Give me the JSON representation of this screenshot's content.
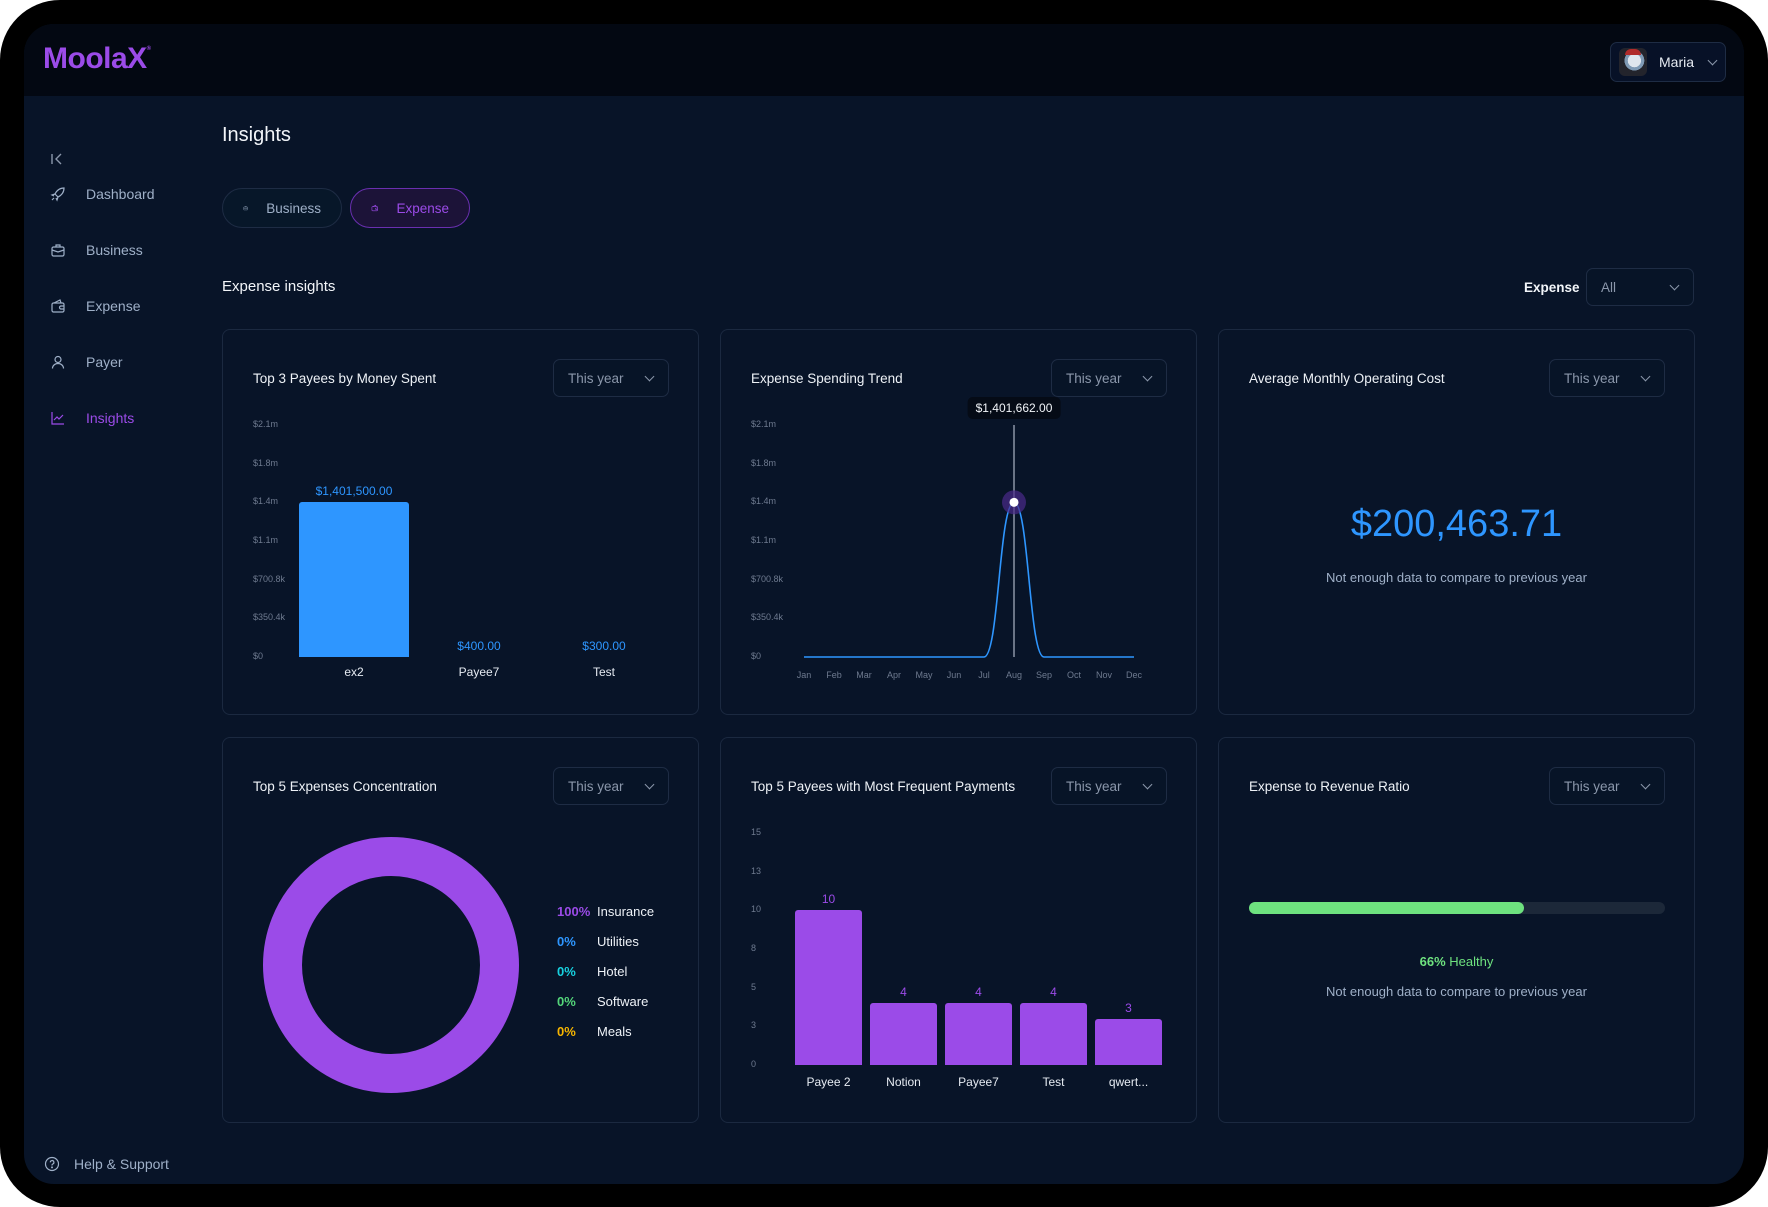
{
  "app": {
    "logo": "MoolaX",
    "logo_mark": "®"
  },
  "user": {
    "name": "Maria"
  },
  "sidebar": {
    "items": [
      {
        "label": "Dashboard",
        "icon": "rocket-icon",
        "active": false
      },
      {
        "label": "Business",
        "icon": "briefcase-icon",
        "active": false
      },
      {
        "label": "Expense",
        "icon": "wallet-icon",
        "active": false
      },
      {
        "label": "Payer",
        "icon": "user-icon",
        "active": false
      },
      {
        "label": "Insights",
        "icon": "chart-line-icon",
        "active": true
      }
    ],
    "help": "Help & Support"
  },
  "page": {
    "title": "Insights",
    "tabs": [
      {
        "label": "Business",
        "active": false
      },
      {
        "label": "Expense",
        "active": true
      }
    ],
    "section_title": "Expense insights",
    "filter": {
      "label": "Expense",
      "value": "All"
    }
  },
  "colors": {
    "accent_purple": "#9b4be8",
    "accent_blue": "#2e96ff",
    "healthy_green": "#6ee27f",
    "legend": [
      "#9b4be8",
      "#2e96ff",
      "#17d1e0",
      "#54d67a",
      "#f7b500"
    ]
  },
  "cards": {
    "top_payees": {
      "title": "Top 3 Payees by Money Spent",
      "period": "This year"
    },
    "spending_trend": {
      "title": "Expense Spending Trend",
      "period": "This year",
      "tooltip": "$1,401,662.00"
    },
    "avg_monthly": {
      "title": "Average Monthly Operating Cost",
      "period": "This year",
      "value": "$200,463.71",
      "note": "Not enough data to compare to previous year"
    },
    "concentration": {
      "title": "Top 5 Expenses Concentration",
      "period": "This year"
    },
    "frequent_payees": {
      "title": "Top 5 Payees with Most Frequent Payments",
      "period": "This year"
    },
    "ratio": {
      "title": "Expense to Revenue Ratio",
      "period": "This year",
      "percent": 66,
      "percent_label": "66%",
      "status": "Healthy",
      "note": "Not enough data to compare to previous year"
    }
  },
  "chart_data": [
    {
      "type": "bar",
      "title": "Top 3 Payees by Money Spent",
      "categories": [
        "ex2",
        "Payee7",
        "Test"
      ],
      "values": [
        1401500,
        400,
        300
      ],
      "value_labels": [
        "$1,401,500.00",
        "$400.00",
        "$300.00"
      ],
      "y_ticks": [
        "$0",
        "$350.4k",
        "$700.8k",
        "$1.1m",
        "$1.4m",
        "$1.8m",
        "$2.1m"
      ],
      "ylim": [
        0,
        2102400
      ],
      "color": "#2e96ff"
    },
    {
      "type": "line",
      "title": "Expense Spending Trend",
      "categories": [
        "Jan",
        "Feb",
        "Mar",
        "Apr",
        "May",
        "Jun",
        "Jul",
        "Aug",
        "Sep",
        "Oct",
        "Nov",
        "Dec"
      ],
      "values": [
        0,
        0,
        0,
        0,
        0,
        0,
        0,
        1401662,
        0,
        0,
        0,
        0
      ],
      "y_ticks": [
        "$0",
        "$350.4k",
        "$700.8k",
        "$1.1m",
        "$1.4m",
        "$1.8m",
        "$2.1m"
      ],
      "ylim": [
        0,
        2102400
      ],
      "highlight": {
        "category": "Aug",
        "label": "$1,401,662.00"
      },
      "color": "#2e96ff"
    },
    {
      "type": "pie",
      "title": "Top 5 Expenses Concentration",
      "categories": [
        "Insurance",
        "Utilities",
        "Hotel",
        "Software",
        "Meals"
      ],
      "values": [
        100,
        0,
        0,
        0,
        0
      ],
      "value_labels": [
        "100%",
        "0%",
        "0%",
        "0%",
        "0%"
      ],
      "donut": true
    },
    {
      "type": "bar",
      "title": "Top 5 Payees with Most Frequent Payments",
      "categories": [
        "Payee 2",
        "Notion",
        "Payee7",
        "Test",
        "qwert..."
      ],
      "values": [
        10,
        4,
        4,
        4,
        3
      ],
      "y_ticks": [
        "0",
        "3",
        "5",
        "8",
        "10",
        "13",
        "15"
      ],
      "ylim": [
        0,
        15
      ],
      "color": "#9b4be8"
    }
  ]
}
